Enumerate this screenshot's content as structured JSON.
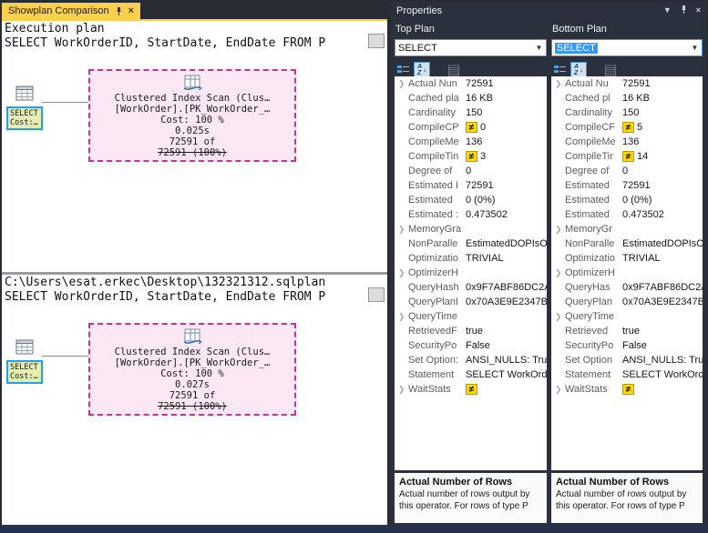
{
  "colors": {
    "tab_gold": "#fcd04e",
    "diff_badge_yellow": "#ffd800",
    "selection_blue": "#3399ff",
    "compare_region_pink": "#fce8f5",
    "compare_region_border": "#c93193",
    "selected_node_border": "#23a0e8",
    "selected_node_fill": "#e5edb2"
  },
  "left": {
    "tab_title": "Showplan Comparison",
    "panels": [
      {
        "title": "Execution plan",
        "query": "SELECT WorkOrderID, StartDate, EndDate FROM P",
        "select_node": {
          "name": "SELECT",
          "cost": "Cost:…"
        },
        "scan_node": {
          "name": "Clustered Index Scan (Clus…",
          "object": "[WorkOrder].[PK_WorkOrder_…",
          "cost": "Cost: 100 %",
          "time": "0.025s",
          "rows1": "72591 of",
          "rows2": "72591 (100%)"
        }
      },
      {
        "title": "C:\\Users\\esat.erkec\\Desktop\\132321312.sqlplan",
        "query": "SELECT WorkOrderID, StartDate, EndDate FROM P",
        "select_node": {
          "name": "SELECT",
          "cost": "Cost:…"
        },
        "scan_node": {
          "name": "Clustered Index Scan (Clus…",
          "object": "[WorkOrder].[PK_WorkOrder_…",
          "cost": "Cost: 100 %",
          "time": "0.027s",
          "rows1": "72591 of",
          "rows2": "72591 (100%)"
        }
      }
    ]
  },
  "properties": {
    "title": "Properties",
    "columns": [
      {
        "header": "Top Plan",
        "combo_value": "SELECT",
        "rows": [
          {
            "exp": true,
            "label": "Actual Nun",
            "diff": false,
            "value": "72591"
          },
          {
            "exp": false,
            "label": "Cached pla",
            "diff": false,
            "value": "16 KB"
          },
          {
            "exp": false,
            "label": "Cardinality",
            "diff": false,
            "value": "150"
          },
          {
            "exp": false,
            "label": "CompileCP",
            "diff": true,
            "value": "0"
          },
          {
            "exp": false,
            "label": "CompileMe",
            "diff": false,
            "value": "136"
          },
          {
            "exp": false,
            "label": "CompileTin",
            "diff": true,
            "value": "3"
          },
          {
            "exp": false,
            "label": "Degree of",
            "diff": false,
            "value": "0"
          },
          {
            "exp": false,
            "label": "Estimated I",
            "diff": false,
            "value": "72591"
          },
          {
            "exp": false,
            "label": "Estimated",
            "diff": false,
            "value": "0 (0%)"
          },
          {
            "exp": false,
            "label": "Estimated :",
            "diff": false,
            "value": "0.473502"
          },
          {
            "exp": true,
            "label": "MemoryGra",
            "diff": false,
            "value": ""
          },
          {
            "exp": false,
            "label": "NonParalle",
            "diff": false,
            "value": "EstimatedDOPIsOr"
          },
          {
            "exp": false,
            "label": "Optimizatio",
            "diff": false,
            "value": "TRIVIAL"
          },
          {
            "exp": true,
            "label": "OptimizerH",
            "diff": false,
            "value": ""
          },
          {
            "exp": false,
            "label": "QueryHash",
            "diff": false,
            "value": "0x9F7ABF86DC2A"
          },
          {
            "exp": false,
            "label": "QueryPlanI",
            "diff": false,
            "value": "0x70A3E9E2347B"
          },
          {
            "exp": true,
            "label": "QueryTime",
            "diff": false,
            "value": ""
          },
          {
            "exp": false,
            "label": "RetrievedF",
            "diff": false,
            "value": "true"
          },
          {
            "exp": false,
            "label": "SecurityPo",
            "diff": false,
            "value": "False"
          },
          {
            "exp": false,
            "label": "Set Option:",
            "diff": false,
            "value": "ANSI_NULLS: Tru"
          },
          {
            "exp": false,
            "label": "Statement",
            "diff": false,
            "value": "SELECT WorkOrd"
          },
          {
            "exp": true,
            "label": "WaitStats",
            "diff": true,
            "value": ""
          }
        ],
        "description": {
          "title": "Actual Number of Rows",
          "text": "Actual number of rows output by this operator. For rows of type P"
        }
      },
      {
        "header": "Bottom Plan",
        "combo_value": "SELECT",
        "rows": [
          {
            "exp": true,
            "label": "Actual Nu",
            "diff": false,
            "value": "72591"
          },
          {
            "exp": false,
            "label": "Cached pl",
            "diff": false,
            "value": "16 KB"
          },
          {
            "exp": false,
            "label": "Cardinality",
            "diff": false,
            "value": "150"
          },
          {
            "exp": false,
            "label": "CompileCF",
            "diff": true,
            "value": "5"
          },
          {
            "exp": false,
            "label": "CompileMe",
            "diff": false,
            "value": "136"
          },
          {
            "exp": false,
            "label": "CompileTir",
            "diff": true,
            "value": "14"
          },
          {
            "exp": false,
            "label": "Degree of",
            "diff": false,
            "value": "0"
          },
          {
            "exp": false,
            "label": "Estimated",
            "diff": false,
            "value": "72591"
          },
          {
            "exp": false,
            "label": "Estimated",
            "diff": false,
            "value": "0 (0%)"
          },
          {
            "exp": false,
            "label": "Estimated",
            "diff": false,
            "value": "0.473502"
          },
          {
            "exp": true,
            "label": "MemoryGr",
            "diff": false,
            "value": ""
          },
          {
            "exp": false,
            "label": "NonParalle",
            "diff": false,
            "value": "EstimatedDOPIsOr"
          },
          {
            "exp": false,
            "label": "Optimizatio",
            "diff": false,
            "value": "TRIVIAL"
          },
          {
            "exp": true,
            "label": "OptimizerH",
            "diff": false,
            "value": ""
          },
          {
            "exp": false,
            "label": "QueryHas",
            "diff": false,
            "value": "0x9F7ABF86DC2A"
          },
          {
            "exp": false,
            "label": "QueryPlan",
            "diff": false,
            "value": "0x70A3E9E2347B"
          },
          {
            "exp": true,
            "label": "QueryTime",
            "diff": false,
            "value": ""
          },
          {
            "exp": false,
            "label": "Retrieved",
            "diff": false,
            "value": "true"
          },
          {
            "exp": false,
            "label": "SecurityPo",
            "diff": false,
            "value": "False"
          },
          {
            "exp": false,
            "label": "Set Option",
            "diff": false,
            "value": "ANSI_NULLS: Tru"
          },
          {
            "exp": false,
            "label": "Statement",
            "diff": false,
            "value": "SELECT WorkOrd"
          },
          {
            "exp": true,
            "label": "WaitStats",
            "diff": true,
            "value": ""
          }
        ],
        "description": {
          "title": "Actual Number of Rows",
          "text": "Actual number of rows output by this operator. For rows of type P"
        }
      }
    ]
  }
}
